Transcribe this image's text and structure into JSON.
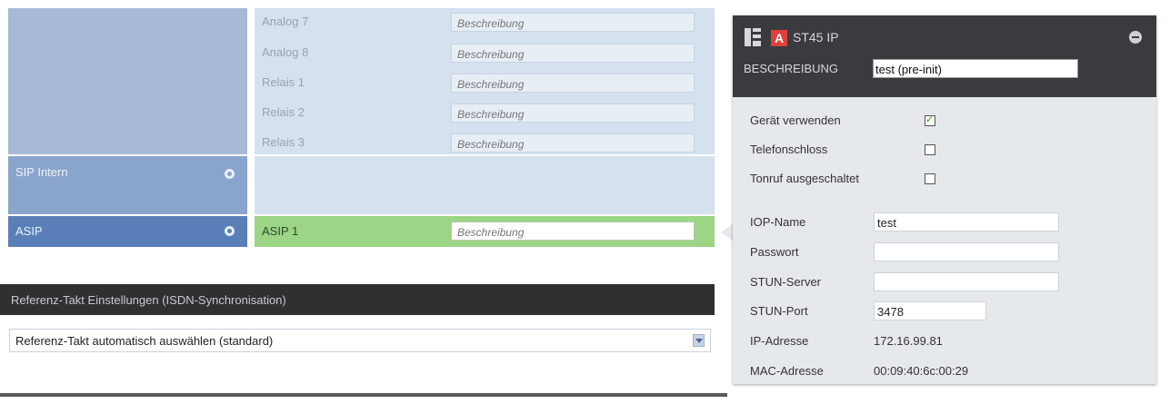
{
  "left": {
    "sip_intern": "SIP Intern",
    "asip": "ASIP"
  },
  "mid": {
    "rows": [
      {
        "label": "Analog 7",
        "placeholder": "Beschreibung"
      },
      {
        "label": "Analog 8",
        "placeholder": "Beschreibung"
      },
      {
        "label": "Relais 1",
        "placeholder": "Beschreibung"
      },
      {
        "label": "Relais 2",
        "placeholder": "Beschreibung"
      },
      {
        "label": "Relais 3",
        "placeholder": "Beschreibung"
      }
    ],
    "asip_row": {
      "label": "ASIP 1",
      "placeholder": "Beschreibung"
    }
  },
  "ref": {
    "header": "Referenz-Takt Einstellungen (ISDN-Synchronisation)",
    "selected": "Referenz-Takt automatisch auswählen (standard)"
  },
  "panel": {
    "title": "ST45 IP",
    "badge": "A",
    "description_label": "BESCHREIBUNG",
    "description_value": "test (pre-init)",
    "checks": [
      {
        "label": "Gerät verwenden",
        "checked": true
      },
      {
        "label": "Telefonschloss",
        "checked": false
      },
      {
        "label": "Tonruf ausgeschaltet",
        "checked": false
      }
    ],
    "fields": {
      "iop_name_label": "IOP-Name",
      "iop_name_value": "test",
      "passwort_label": "Passwort",
      "passwort_value": "",
      "stun_server_label": "STUN-Server",
      "stun_server_value": "",
      "stun_port_label": "STUN-Port",
      "stun_port_value": "3478",
      "ip_label": "IP-Adresse",
      "ip_value": "172.16.99.81",
      "mac_label": "MAC-Adresse",
      "mac_value": "00:09:40:6c:00:29"
    }
  },
  "colors": {
    "accent_green": "#9bd585",
    "nav_blue": "#5a7fb8",
    "header_dark": "#2f3032",
    "badge_red": "#e0403c"
  }
}
